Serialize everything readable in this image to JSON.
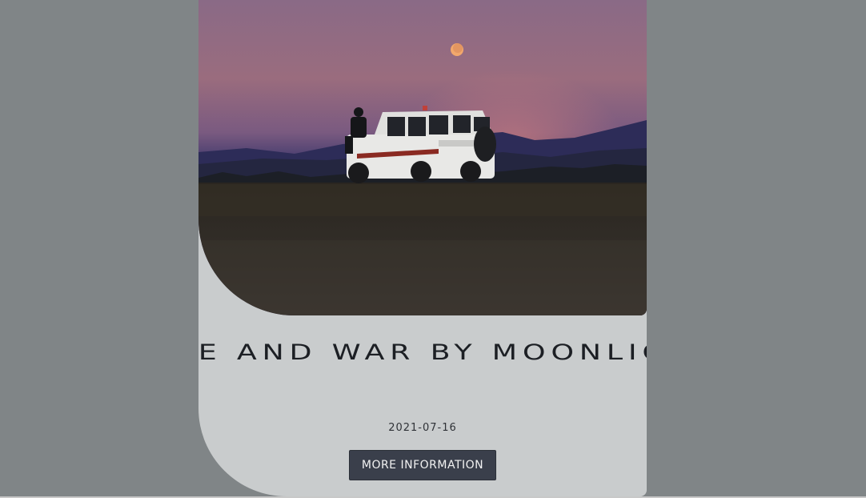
{
  "card": {
    "title": "Love and War by Moonlight",
    "date": "2021-07-16",
    "button_label": "More information"
  },
  "colors": {
    "page_background": "#808587",
    "card_background": "#c9cccd",
    "button_background": "#3a3f4b",
    "title_color": "#1c1f24"
  }
}
